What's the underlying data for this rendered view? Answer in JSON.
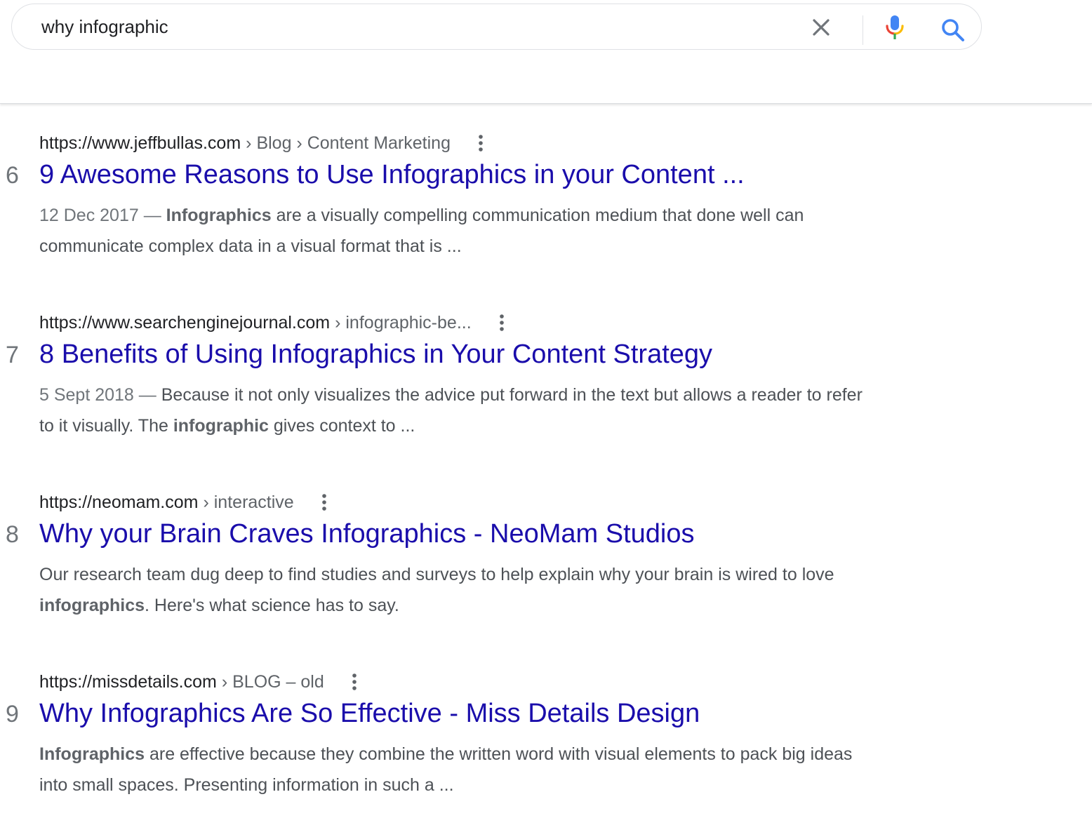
{
  "search": {
    "query": "why infographic"
  },
  "icons": {
    "clear": "close-icon",
    "mic": "microphone-icon",
    "search": "search-icon",
    "more": "more-vert-icon"
  },
  "colors": {
    "link": "#1a0dab",
    "google_blue": "#4285f4",
    "google_red": "#ea4335",
    "google_yellow": "#fbbc04",
    "google_green": "#34a853"
  },
  "results": [
    {
      "number": "6",
      "domain": "https://www.jeffbullas.com",
      "path": "› Blog › Content Marketing",
      "title": "9 Awesome Reasons to Use Infographics in your Content ...",
      "date": "12 Dec 2017 —",
      "s1": "",
      "bold": "Infographics",
      "s2": " are a visually compelling communication medium that done well can communicate complex data in a visual format that is ..."
    },
    {
      "number": "7",
      "domain": "https://www.searchenginejournal.com",
      "path": "› infographic-be...",
      "title": "8 Benefits of Using Infographics in Your Content Strategy",
      "date": "5 Sept 2018 —",
      "s1": "Because it not only visualizes the advice put forward in the text but allows a reader to refer to it visually. The ",
      "bold": "infographic",
      "s2": " gives context to ..."
    },
    {
      "number": "8",
      "domain": "https://neomam.com",
      "path": "› interactive",
      "title": "Why your Brain Craves Infographics - NeoMam Studios",
      "date": "",
      "s1": "Our research team dug deep to find studies and surveys to help explain why your brain is wired to love ",
      "bold": "infographics",
      "s2": ". Here's what science has to say."
    },
    {
      "number": "9",
      "domain": "https://missdetails.com",
      "path": "› BLOG – old",
      "title": "Why Infographics Are So Effective - Miss Details Design",
      "date": "",
      "s1": "",
      "bold": "Infographics",
      "s2": " are effective because they combine the written word with visual elements to pack big ideas into small spaces. Presenting information in such a ..."
    }
  ]
}
